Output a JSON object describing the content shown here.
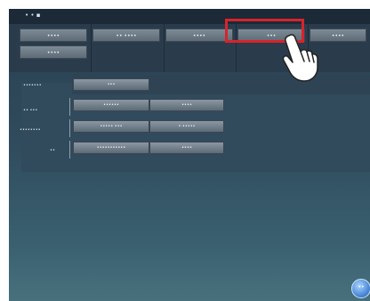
{
  "app": {
    "title": "• • ▪"
  },
  "tabs": [
    {
      "label": "••••"
    },
    {
      "label": "•• ••••"
    },
    {
      "label": "••••"
    },
    {
      "label": "•••"
    },
    {
      "label": "••••"
    },
    {
      "label": "••••"
    }
  ],
  "rows": [
    {
      "label": "•••••••",
      "buttons": [
        "•••"
      ]
    },
    {
      "label": "•• •••",
      "buttons": [
        "••••••",
        "••••"
      ]
    },
    {
      "label": "••••••••",
      "buttons": [
        "••••• •••",
        "• •••••"
      ]
    },
    {
      "label": "••",
      "buttons": [
        "•••••••••••",
        "••••"
      ]
    }
  ],
  "footer": {
    "circle_label": "••"
  },
  "icons": {
    "hand": "pointing-hand-icon",
    "highlight": "red-highlight-box"
  },
  "colors": {
    "highlight": "#d9232b",
    "accent": "#3f7fd0"
  }
}
